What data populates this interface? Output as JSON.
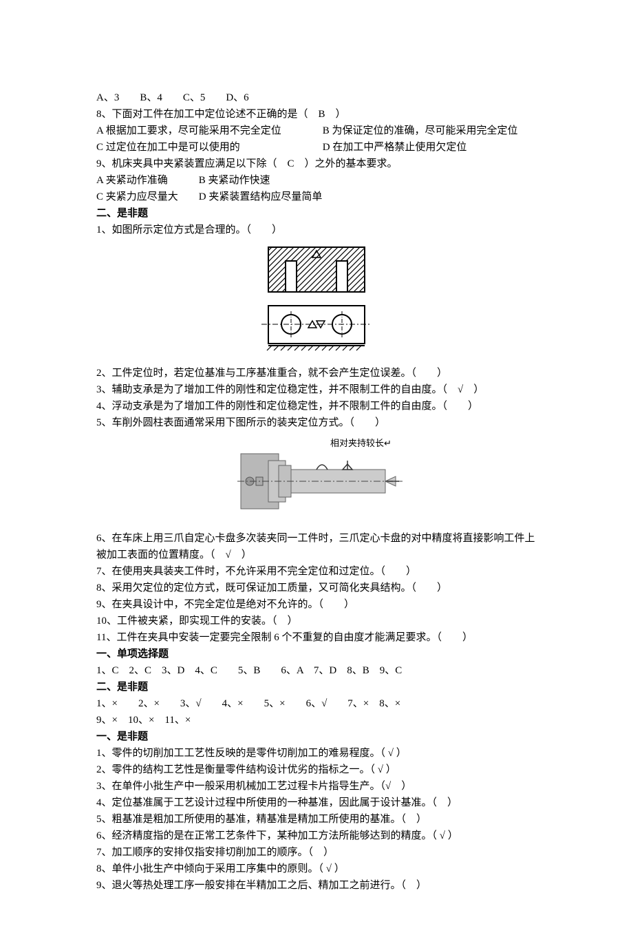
{
  "lines": {
    "l1": "A、3　　B、4　　C、5　　D、6",
    "l2": "8、下面对工件在加工中定位论述不正确的是（　B　）",
    "l3": "A 根据加工要求，尽可能采用不完全定位　　　　B 为保证定位的准确，尽可能采用完全定位",
    "l4": "C 过定位在加工中是可以使用的　　　　　　　　D 在加工中严格禁止使用欠定位",
    "l5": "9、机床夹具中夹紧装置应满足以下除（　C　）之外的基本要求。",
    "l6": "A 夹紧动作准确　　　B 夹紧动作快速",
    "l7": "C 夹紧力应尽量大　　D 夹紧装置结构应尽量简单",
    "s1": "二、是非题",
    "l8": "1、如图所示定位方式是合理的。（　　）",
    "l9": "2、工件定位时，若定位基准与工序基准重合，就不会产生定位误差。（　　）",
    "l10": "3、辅助支承是为了增加工件的刚性和定位稳定性，并不限制工件的自由度。（　√　）",
    "l11": "4、浮动支承是为了增加工件的刚性和定位稳定性，并不限制工件的自由度。（　　）",
    "l12": "5、车削外圆柱表面通常采用下图所示的装夹定位方式。（　　）",
    "fig2_label": "相对夹持较长↵",
    "l13": "6、在车床上用三爪自定心卡盘多次装夹同一工件时，三爪定心卡盘的对中精度将直接影响工件上被加工表面的位置精度。（　√　）",
    "l14": "7、在使用夹具装夹工件时，不允许采用不完全定位和过定位。（　　）",
    "l15": "8、采用欠定位的定位方式，既可保证加工质量，又可简化夹具结构。（　　）",
    "l16": "9、在夹具设计中，不完全定位是绝对不允许的。（　　）",
    "l17": "10、工件被夹紧，即实现工件的安装。（　）",
    "l18": "11、工件在夹具中安装一定要完全限制 6 个不重复的自由度才能满足要求。（　　）",
    "s2": "一、单项选择题",
    "a1": "1、C　2、C　3、D　4、C　　5、B　　6、A　7、D　8、B　9、C",
    "s3": "二、是非题",
    "a2": "1、×　　2、×　　3、√　　4、×　　5、×　　6、√　　7、×　8、×",
    "a3": "9、×　10、×　11、×",
    "s4": "一、是非题",
    "l19": "1、零件的切削加工工艺性反映的是零件切削加工的难易程度。（ √ ）",
    "l20": "2、零件的结构工艺性是衡量零件结构设计优劣的指标之一。（ √ ）",
    "l21": "3、在单件小批生产中一般采用机械加工艺过程卡片指导生产。（√　）",
    "l22": "4、定位基准属于工艺设计过程中所使用的一种基准，因此属于设计基准。（　）",
    "l23": "5、粗基准是粗加工所使用的基准，精基准是精加工所使用的基准。（　）",
    "l24": "6、经济精度指的是在正常工艺条件下，某种加工方法所能够达到的精度。（ √ ）",
    "l25": "7、加工顺序的安排仅指安排切削加工的顺序。（　）",
    "l26": "8、单件小批生产中倾向于采用工序集中的原则。（ √ ）",
    "l27": "9、退火等热处理工序一般安排在半精加工之后、精加工之前进行。（　）"
  }
}
